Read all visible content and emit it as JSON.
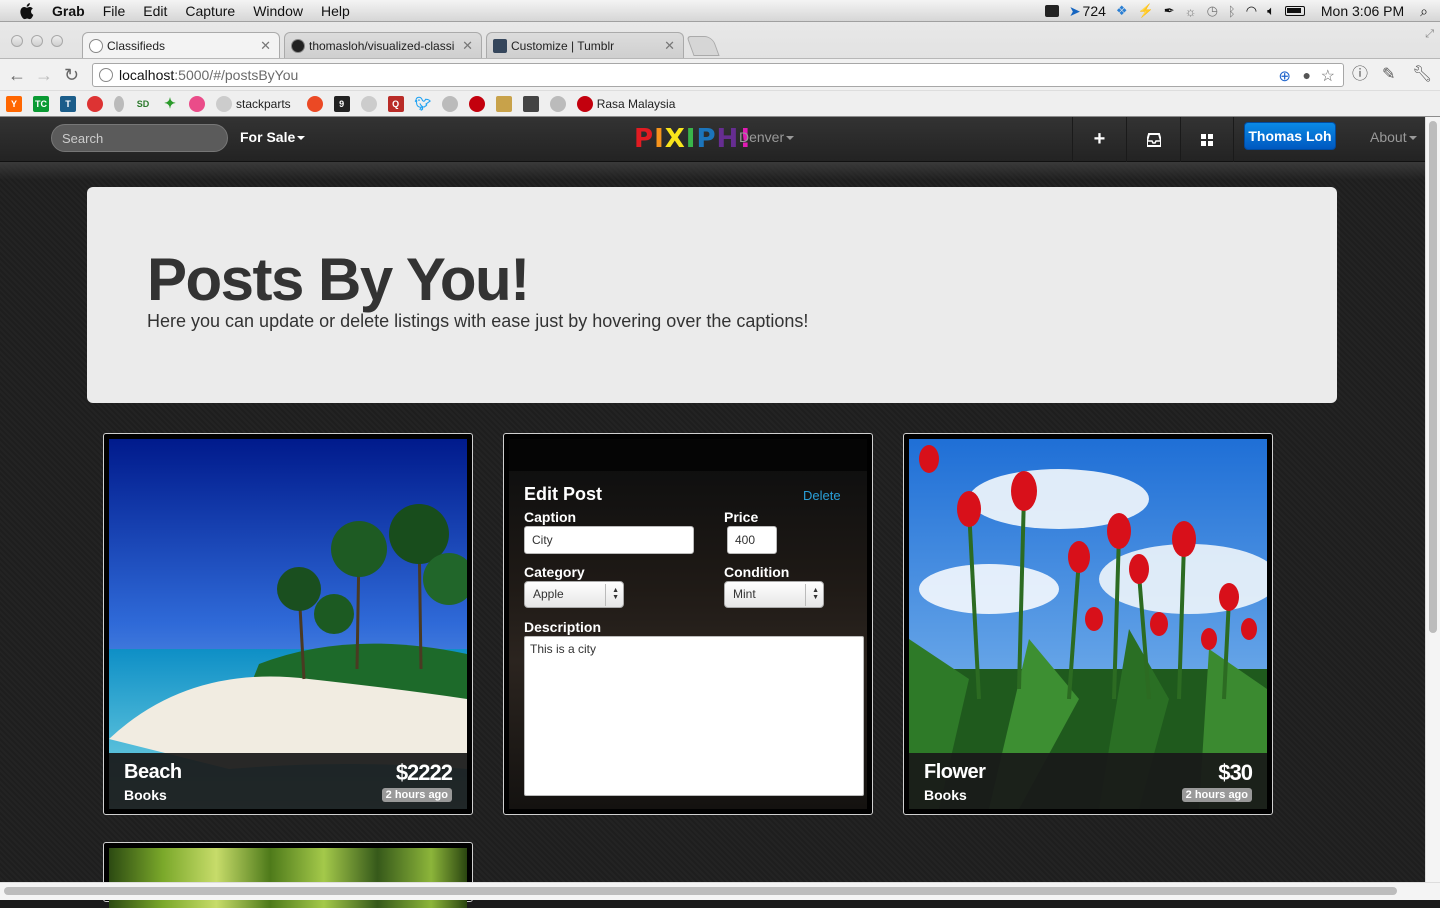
{
  "menubar": {
    "app": "Grab",
    "items": [
      "File",
      "Edit",
      "Capture",
      "Window",
      "Help"
    ],
    "badge_count": "724",
    "clock": "Mon 3:06 PM"
  },
  "browser": {
    "tabs": [
      {
        "label": "Classifieds"
      },
      {
        "label": "thomasloh/visualized-classi"
      },
      {
        "label": "Customize | Tumblr"
      }
    ],
    "url_host": "localhost",
    "url_path": ":5000/#/postsByYou",
    "bookmarks": [
      {
        "icon": "hn-icon",
        "text": "Y",
        "color": "#ff6600"
      },
      {
        "icon": "techcrunch-icon",
        "text": "TC",
        "color": "#0a9a33"
      },
      {
        "icon": "t-icon",
        "text": "T",
        "color": "#1b5d8a"
      },
      {
        "icon": "apple-icon",
        "text": "",
        "color": "#d33"
      },
      {
        "icon": "kiwi-icon",
        "text": "",
        "color": "#aaa"
      },
      {
        "icon": "sd-icon",
        "text": "SD",
        "color": "#2c7a2c"
      },
      {
        "icon": "plant-icon",
        "text": "",
        "color": "#2a9a2a"
      },
      {
        "icon": "dribbble-icon",
        "text": "",
        "color": "#ea4c89"
      }
    ],
    "bookmark_stackparts": "stackparts",
    "bookmarks2": [
      {
        "icon": "stumble-icon",
        "text": "",
        "color": "#eb4924"
      },
      {
        "icon": "9gag-icon",
        "text": "9",
        "color": "#222"
      },
      {
        "icon": "reddit-icon",
        "text": "",
        "color": "#ccc"
      },
      {
        "icon": "quora-icon",
        "text": "Q",
        "color": "#b92b27"
      },
      {
        "icon": "twitter-icon",
        "text": "",
        "color": "#1da1f2"
      },
      {
        "icon": "cup-icon",
        "text": "",
        "color": "#999"
      },
      {
        "icon": "lastfm-icon",
        "text": "",
        "color": "#c3000d"
      },
      {
        "icon": "photo-icon",
        "text": "",
        "color": "#c8a24a"
      },
      {
        "icon": "page-icon",
        "text": "",
        "color": "#444"
      },
      {
        "icon": "globe-icon",
        "text": "",
        "color": "#bbb"
      }
    ],
    "bookmark_rasa": "Rasa Malaysia"
  },
  "navbar": {
    "search_placeholder": "Search",
    "category": "For Sale",
    "logo_letters": [
      "P",
      "I",
      "X",
      "I",
      "P",
      "H",
      "!"
    ],
    "logo_colors": [
      "#e11b22",
      "#f7941d",
      "#f9e51c",
      "#39b54a",
      "#1c75bc",
      "#662d91",
      "#e11bb4"
    ],
    "city": "Denver",
    "user": "Thomas Loh",
    "about": "About"
  },
  "hero": {
    "title": "Posts By You!",
    "subtitle": "Here you can update or delete listings with ease just by hovering over the captions!"
  },
  "posts": [
    {
      "title": "Beach",
      "category": "Books",
      "price": "$2222",
      "time": "2 hours ago"
    },
    {
      "title": "Flower",
      "category": "Books",
      "price": "$30",
      "time": "2 hours ago"
    }
  ],
  "edit_form": {
    "heading": "Edit Post",
    "delete_label": "Delete",
    "caption_label": "Caption",
    "caption_value": "City",
    "price_label": "Price",
    "price_value": "400",
    "category_label": "Category",
    "category_value": "Apple",
    "condition_label": "Condition",
    "condition_value": "Mint",
    "description_label": "Description",
    "description_value": "This is a city"
  }
}
